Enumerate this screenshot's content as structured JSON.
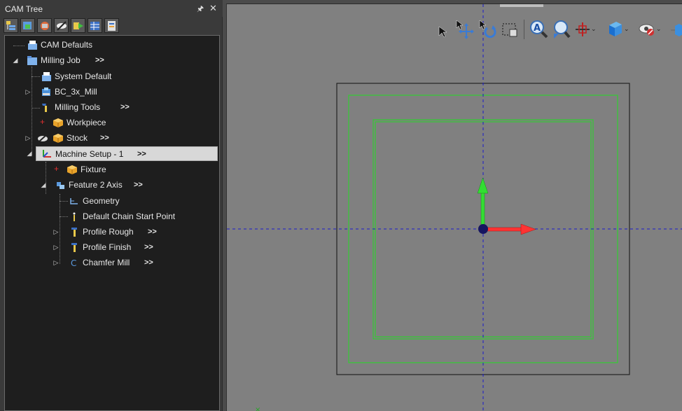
{
  "panel": {
    "title": "CAM Tree",
    "pin_icon": "pin-icon",
    "close_icon": "close-icon"
  },
  "toolbar_icons": [
    "tree-expand-icon",
    "new-operation-icon",
    "toolpath-icon",
    "hide-toolpath-icon",
    "simulate-icon",
    "grid-view-icon",
    "properties-icon"
  ],
  "tree": {
    "cam_defaults": "CAM Defaults",
    "milling_job": "Milling Job",
    "system_default": "System Default",
    "bc_3x_mill": "BC_3x_Mill",
    "milling_tools": "Milling Tools",
    "workpiece": "Workpiece",
    "stock": "Stock",
    "machine_setup": "Machine Setup - 1",
    "fixture": "Fixture",
    "feature_2_axis": "Feature 2 Axis",
    "geometry": "Geometry",
    "default_chain_start_point": "Default Chain Start Point",
    "profile_rough": "Profile Rough",
    "profile_finish": "Profile Finish",
    "chamfer_mill": "Chamfer Mill",
    "more": ">>"
  },
  "view_toolbar_icons": [
    "select-arrow-icon",
    "pan-icon",
    "rotate-icon",
    "zoom-window-icon",
    "zoom-fit-icon",
    "zoom-icon",
    "origin-icon",
    "view-cube-icon",
    "visibility-icon",
    "more-icon"
  ],
  "colors": {
    "panel_bg": "#3a3a3a",
    "tree_bg": "#1e1e1e",
    "viewport_bg": "#808080",
    "stock_outline": "#111111",
    "part_outline": "#22dd22",
    "axis_x": "#ff3333",
    "axis_y": "#33dd33",
    "crosshair": "#1a1acc"
  }
}
